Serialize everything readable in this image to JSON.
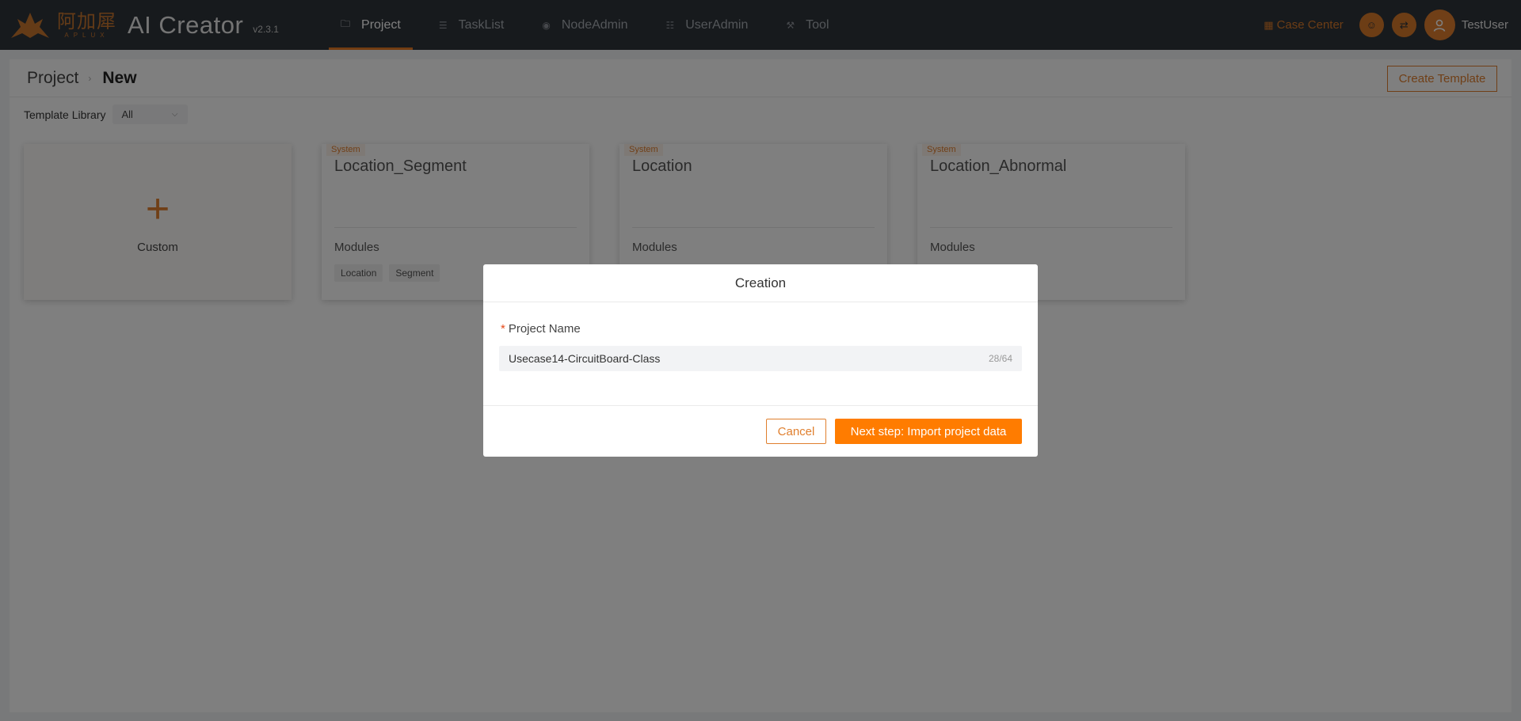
{
  "brand": {
    "cn_name": "阿加犀",
    "en_name": "APLUX",
    "app_title": "AI Creator",
    "version": "v2.3.1"
  },
  "nav": {
    "items": [
      {
        "label": "Project",
        "icon": "folder-icon",
        "active": true
      },
      {
        "label": "TaskList",
        "icon": "list-icon",
        "active": false
      },
      {
        "label": "NodeAdmin",
        "icon": "node-icon",
        "active": false
      },
      {
        "label": "UserAdmin",
        "icon": "users-icon",
        "active": false
      },
      {
        "label": "Tool",
        "icon": "wrench-icon",
        "active": false
      }
    ]
  },
  "header_right": {
    "case_center": "Case Center",
    "username": "TestUser"
  },
  "breadcrumb": {
    "parent": "Project",
    "current": "New"
  },
  "toolbar": {
    "create_template": "Create Template"
  },
  "filter": {
    "label": "Template Library",
    "selected": "All"
  },
  "custom_card": {
    "label": "Custom"
  },
  "templates": [
    {
      "tag": "System",
      "title": "Location_Segment",
      "modules_label": "Modules",
      "modules": [
        "Location",
        "Segment"
      ]
    },
    {
      "tag": "System",
      "title": "Location",
      "modules_label": "Modules",
      "modules": []
    },
    {
      "tag": "System",
      "title": "Location_Abnormal",
      "modules_label": "Modules",
      "modules": []
    }
  ],
  "dialog": {
    "title": "Creation",
    "field_label": "Project Name",
    "required_mark": "*",
    "field_value": "Usecase14-CircuitBoard-Class",
    "char_count": "28/64",
    "cancel": "Cancel",
    "next": "Next step: Import project data"
  },
  "colors": {
    "accent": "#e07f2e",
    "primary_button": "#ff7c00",
    "topbar": "#2f343b"
  }
}
